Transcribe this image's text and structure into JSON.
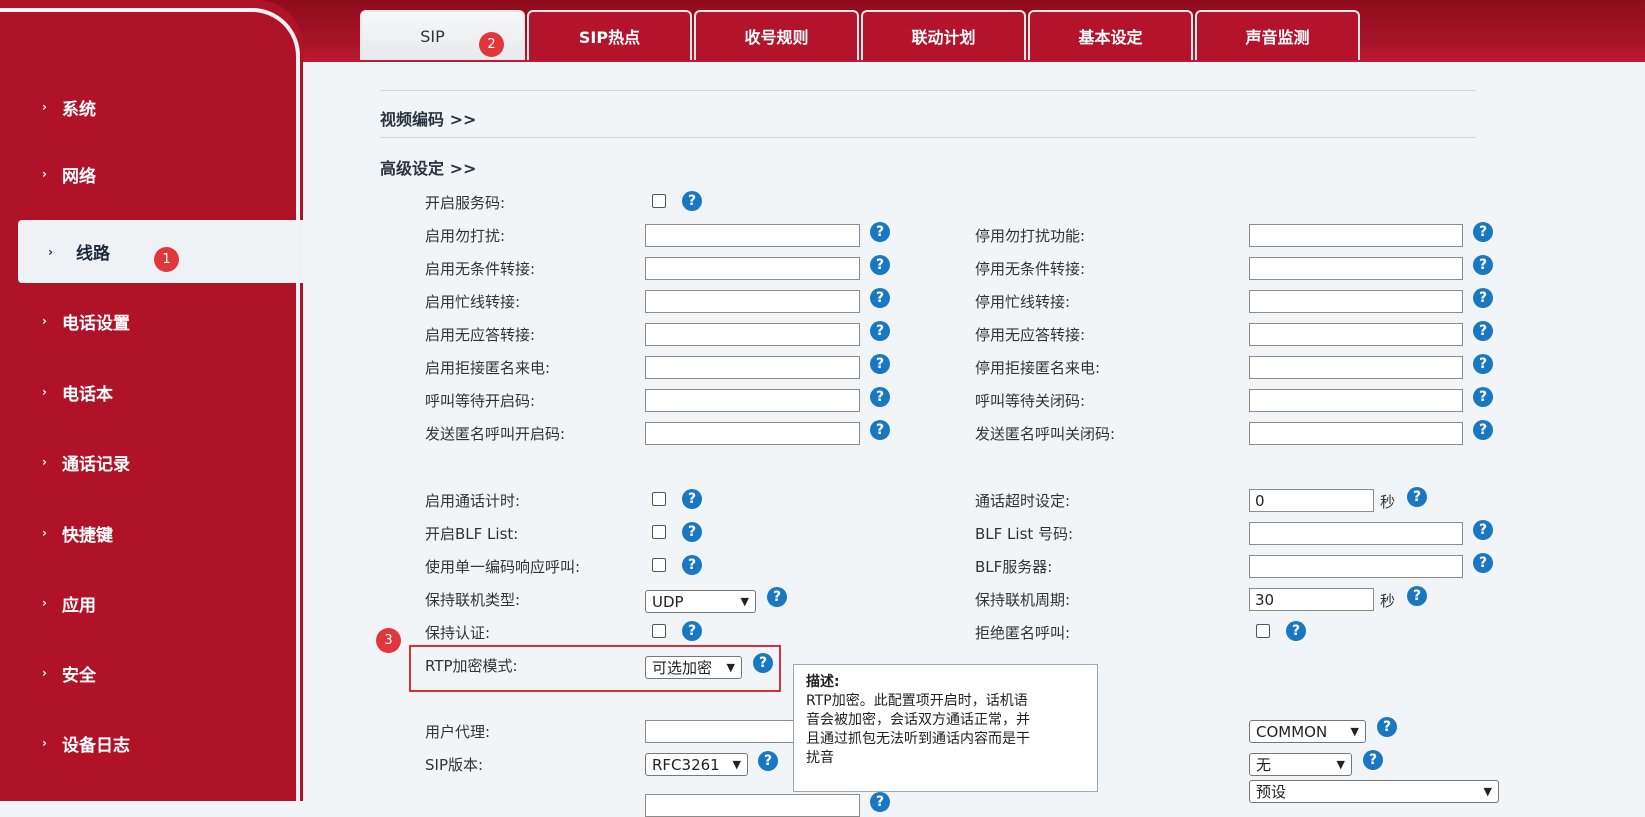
{
  "sidebar": {
    "items": [
      {
        "label": "系统"
      },
      {
        "label": "网络"
      },
      {
        "label": "线路"
      },
      {
        "label": "电话设置"
      },
      {
        "label": "电话本"
      },
      {
        "label": "通话记录"
      },
      {
        "label": "快捷键"
      },
      {
        "label": "应用"
      },
      {
        "label": "安全"
      },
      {
        "label": "设备日志"
      }
    ],
    "active_badge": "1"
  },
  "tabs": {
    "items": [
      {
        "label": "SIP"
      },
      {
        "label": "SIP热点"
      },
      {
        "label": "收号规则"
      },
      {
        "label": "联动计划"
      },
      {
        "label": "基本设定"
      },
      {
        "label": "声音监测"
      }
    ],
    "active_badge": "2"
  },
  "sections": {
    "video_codec": "视频编码 >>",
    "advanced": "高级设定 >>"
  },
  "help_glyph": "?",
  "fields": {
    "enable_service_code": "开启服务码:",
    "dnd_on": "启用勿打扰:",
    "dnd_off": "停用勿打扰功能:",
    "cfu_on": "启用无条件转接:",
    "cfu_off": "停用无条件转接:",
    "cfb_on": "启用忙线转接:",
    "cfb_off": "停用忙线转接:",
    "cfna_on": "启用无应答转接:",
    "cfna_off": "停用无应答转接:",
    "reject_anon_on": "启用拒接匿名来电:",
    "reject_anon_off": "停用拒接匿名来电:",
    "cw_on": "呼叫等待开启码:",
    "cw_off": "呼叫等待关闭码:",
    "anon_call_on": "发送匿名呼叫开启码:",
    "anon_call_off": "发送匿名呼叫关闭码:",
    "call_timer": "启用通话计时:",
    "call_timeout": "通话超时设定:",
    "call_timeout_value": "0",
    "blf_list": "开启BLF List:",
    "blf_number": "BLF List 号码:",
    "single_codec": "使用单一编码响应呼叫:",
    "blf_server": "BLF服务器:",
    "keepalive_type": "保持联机类型:",
    "keepalive_type_value": "UDP",
    "keepalive_period": "保持联机周期:",
    "keepalive_period_value": "30",
    "keepalive_auth": "保持认证:",
    "reject_anon_call": "拒绝匿名呼叫:",
    "rtp_mode": "RTP加密模式:",
    "rtp_mode_value": "可选加密",
    "user_agent": "用户代理:",
    "common_value": "COMMON",
    "sip_version": "SIP版本:",
    "sip_version_value": "RFC3261",
    "none_value": "无",
    "preset_value": "预设",
    "seconds_unit": "秒"
  },
  "highlight_badge": "3",
  "tooltip": {
    "title": "描述:",
    "line1": "RTP加密。此配置项开启时，话机语",
    "line2": "音会被加密，会话双方通话正常，并",
    "line3": "且通过抓包无法听到通话内容而是干",
    "line4": "扰音"
  }
}
